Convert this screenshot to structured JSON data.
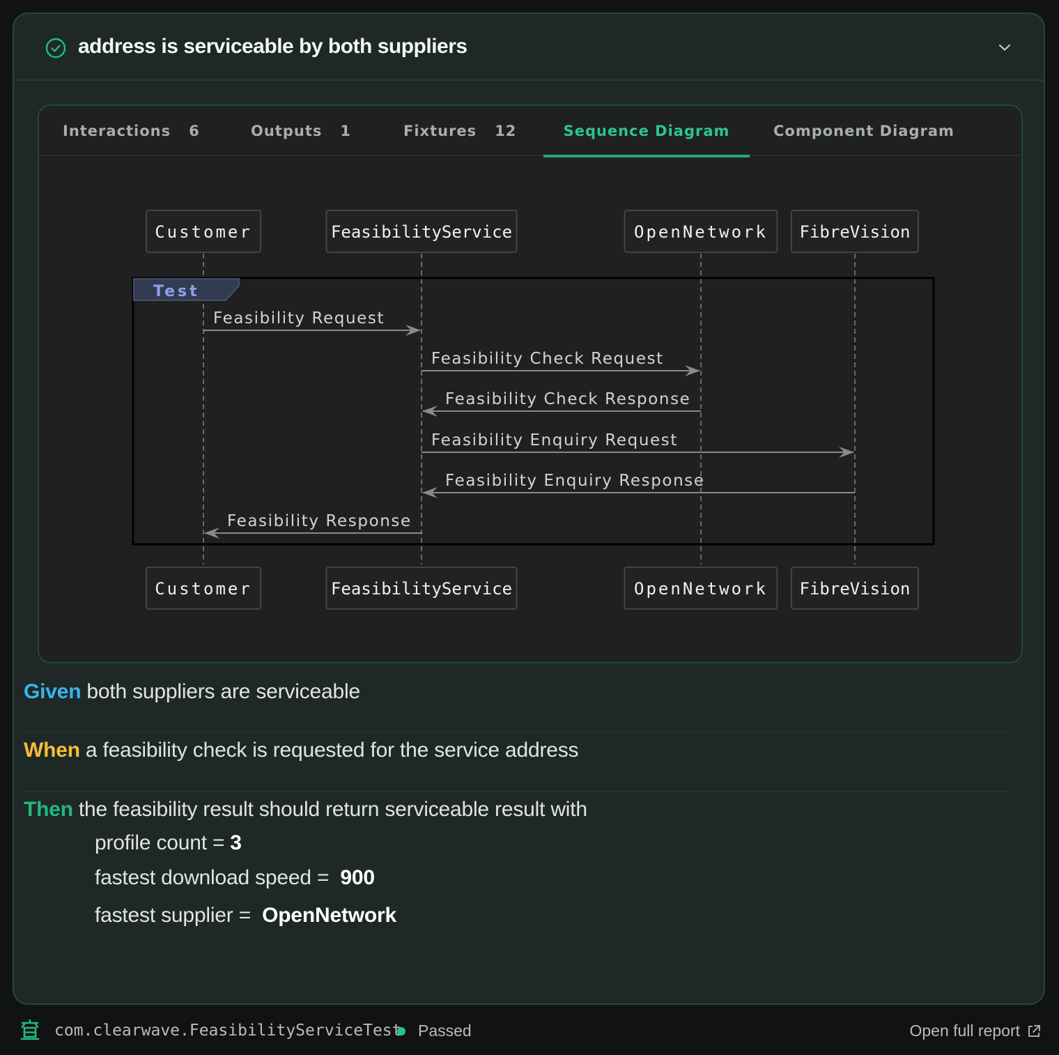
{
  "header": {
    "title": "address is serviceable by both suppliers",
    "status_icon": "check-circle-icon",
    "collapse_icon": "chevron-down-icon"
  },
  "tabs": [
    {
      "label": "Interactions",
      "count": "6"
    },
    {
      "label": "Outputs",
      "count": "1"
    },
    {
      "label": "Fixtures",
      "count": "12"
    },
    {
      "label": "Sequence Diagram",
      "count": ""
    },
    {
      "label": "Component Diagram",
      "count": ""
    }
  ],
  "active_tab": "Sequence Diagram",
  "diagram": {
    "participants": [
      "Customer",
      "FeasibilityService",
      "OpenNetwork",
      "FibreVision"
    ],
    "frame_label": "Test",
    "messages": [
      {
        "from": "Customer",
        "to": "FeasibilityService",
        "label": "Feasibility Request"
      },
      {
        "from": "FeasibilityService",
        "to": "OpenNetwork",
        "label": "Feasibility Check Request"
      },
      {
        "from": "OpenNetwork",
        "to": "FeasibilityService",
        "label": "Feasibility Check Response"
      },
      {
        "from": "FeasibilityService",
        "to": "FibreVision",
        "label": "Feasibility Enquiry Request"
      },
      {
        "from": "FibreVision",
        "to": "FeasibilityService",
        "label": "Feasibility Enquiry Response"
      },
      {
        "from": "FeasibilityService",
        "to": "Customer",
        "label": "Feasibility Response"
      }
    ]
  },
  "steps": {
    "given": {
      "keyword": "Given",
      "text": "both suppliers are serviceable"
    },
    "when": {
      "keyword": "When",
      "text": "a feasibility check is requested for the service address"
    },
    "then": {
      "keyword": "Then",
      "text": "the feasibility result should return serviceable result with",
      "params": [
        {
          "label": "profile count =",
          "value": "3"
        },
        {
          "label": "fastest download speed = ",
          "value": "900"
        },
        {
          "label": "fastest supplier = ",
          "value": "OpenNetwork"
        }
      ]
    }
  },
  "colors": {
    "given": "#3ab4ee",
    "when": "#f3bf35",
    "then": "#22b97d",
    "accent": "#2cc58f",
    "status_passed": "#26c486"
  },
  "footer": {
    "class_name": "com.clearwave.FeasibilityServiceTest",
    "status": "Passed",
    "open_report": "Open full report",
    "logo_icon": "test-suite-icon",
    "external_icon": "external-link-icon"
  }
}
